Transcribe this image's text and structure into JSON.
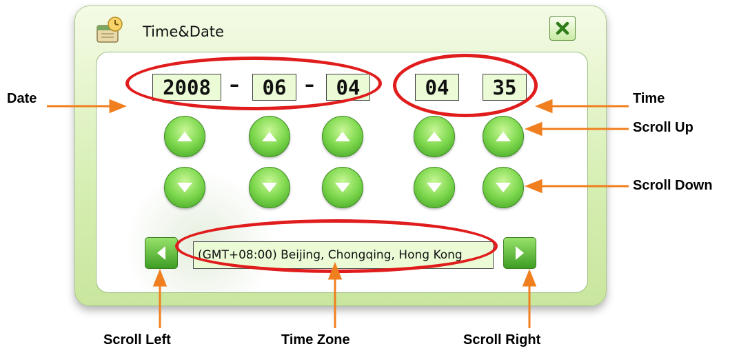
{
  "window": {
    "title": "Time&Date",
    "icon": "calendar-clock-icon",
    "close_icon": "close-icon"
  },
  "date": {
    "year": "2008",
    "month": "06",
    "day": "04",
    "separator": "–"
  },
  "time": {
    "hour": "04",
    "minute": "35"
  },
  "timezone": {
    "value": "(GMT+08:00) Beijing, Chongqing, Hong Kong"
  },
  "callouts": {
    "date": "Date",
    "time": "Time",
    "scroll_up": "Scroll Up",
    "scroll_down": "Scroll Down",
    "scroll_left": "Scroll Left",
    "time_zone": "Time Zone",
    "scroll_right": "Scroll Right"
  },
  "colors": {
    "window_bg": "#d6eeb2",
    "field_bg": "#eafbd6",
    "button_green": "#7ed84e",
    "highlight_red": "#e01c1c",
    "arrow_orange": "#f07f1f"
  }
}
